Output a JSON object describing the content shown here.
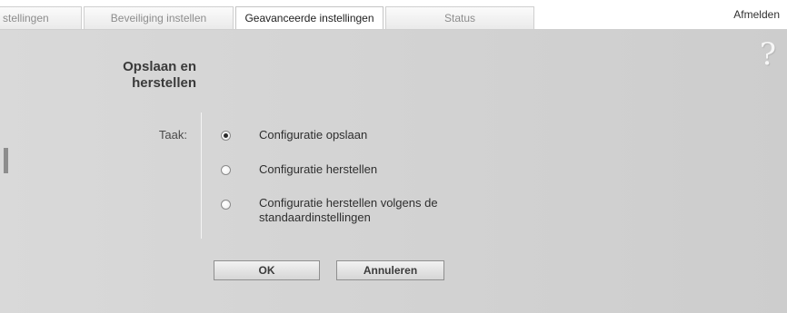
{
  "tabs": [
    {
      "label": "stellingen",
      "active": false
    },
    {
      "label": "Beveiliging instellen",
      "active": false
    },
    {
      "label": "Geavanceerde instellingen",
      "active": true
    },
    {
      "label": "Status",
      "active": false
    }
  ],
  "logout_label": "Afmelden",
  "help_glyph": "?",
  "section": {
    "title_line1": "Opslaan en",
    "title_line2": "herstellen"
  },
  "task": {
    "label": "Taak:",
    "options": [
      {
        "label": "Configuratie opslaan",
        "checked": true
      },
      {
        "label": "Configuratie herstellen",
        "checked": false
      },
      {
        "label_line1": "Configuratie herstellen volgens de",
        "label_line2": "standaardinstellingen",
        "checked": false
      }
    ]
  },
  "buttons": {
    "ok": "OK",
    "cancel": "Annuleren"
  }
}
